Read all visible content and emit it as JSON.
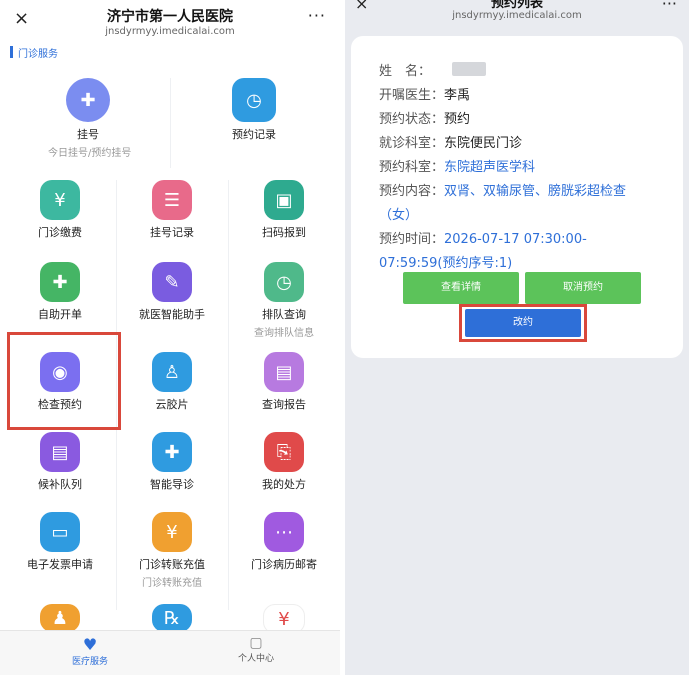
{
  "left": {
    "title": "济宁市第一人民医院",
    "subtitle": "jnsdyrmyy.imedicalai.com",
    "close_icon": "×",
    "more_icon": "···",
    "section": "门诊服务",
    "items": [
      {
        "label": "挂号",
        "sub": "今日挂号/预约挂号",
        "icon": "stethoscope-icon",
        "color": "#7b8df0"
      },
      {
        "label": "预约记录",
        "sub": "",
        "icon": "clock-icon",
        "color": "#2f9be0"
      },
      {
        "label": "门诊缴费",
        "sub": "",
        "icon": "yuan-house-icon",
        "color": "#3db8a0"
      },
      {
        "label": "挂号记录",
        "sub": "",
        "icon": "list-icon",
        "color": "#e86a8a"
      },
      {
        "label": "扫码报到",
        "sub": "",
        "icon": "scan-icon",
        "color": "#2eaa8f"
      },
      {
        "label": "自助开单",
        "sub": "",
        "icon": "form-icon",
        "color": "#45b565"
      },
      {
        "label": "就医智能助手",
        "sub": "",
        "icon": "assistant-icon",
        "color": "#7a5ce0"
      },
      {
        "label": "排队查询",
        "sub": "查询排队信息",
        "icon": "queue-icon",
        "color": "#4fb98a"
      },
      {
        "label": "检查预约",
        "sub": "",
        "icon": "planet-icon",
        "color": "#7b6ff0"
      },
      {
        "label": "云胶片",
        "sub": "",
        "icon": "body-icon",
        "color": "#2f9be0"
      },
      {
        "label": "查询报告",
        "sub": "",
        "icon": "report-icon",
        "color": "#b77ae0"
      },
      {
        "label": "候补队列",
        "sub": "",
        "icon": "doc-icon",
        "color": "#8a5ae0"
      },
      {
        "label": "智能导诊",
        "sub": "",
        "icon": "hospital-icon",
        "color": "#2f9be0"
      },
      {
        "label": "我的处方",
        "sub": "",
        "icon": "prescription-icon",
        "color": "#e04a4a"
      },
      {
        "label": "电子发票申请",
        "sub": "",
        "icon": "invoice-icon",
        "color": "#2f9be0"
      },
      {
        "label": "门诊转账充值",
        "sub": "门诊转账充值",
        "icon": "transfer-icon",
        "color": "#f0a030"
      },
      {
        "label": "门诊病历邮寄",
        "sub": "",
        "icon": "mail-icon",
        "color": "#a05ae0"
      }
    ],
    "glyphs": [
      "✚",
      "◷",
      "¥",
      "☰",
      "▣",
      "✚",
      "✎",
      "◷",
      "◉",
      "♙",
      "▤",
      "▤",
      "✚",
      "⎘",
      "▭",
      "¥",
      "⋯"
    ],
    "partial_glyphs": [
      "♟",
      "℞",
      "¥"
    ],
    "tabs": [
      {
        "label": "医疗服务",
        "icon": "heart-icon",
        "color": "#2e6fd8"
      },
      {
        "label": "个人中心",
        "icon": "person-icon",
        "color": "#555555"
      }
    ],
    "tab_glyphs": [
      "♥",
      "▢"
    ]
  },
  "right": {
    "title": "预约列表",
    "subtitle": "jnsdyrmyy.imedicalai.com",
    "close_icon": "×",
    "more_icon": "···",
    "fields": [
      {
        "key": "姓　名：",
        "value": "",
        "style": "v"
      },
      {
        "key": "开嘱医生：",
        "value": "李禹",
        "style": "v"
      },
      {
        "key": "预约状态：",
        "value": "预约",
        "style": "v"
      },
      {
        "key": "就诊科室：",
        "value": "东院便民门诊",
        "style": "v"
      },
      {
        "key": "预约科室：",
        "value": "东院超声医学科",
        "style": "blue"
      },
      {
        "key": "预约内容：",
        "value": "双肾、双输尿管、膀胱彩超检查",
        "style": "blue"
      },
      {
        "key": "",
        "value": "（女）",
        "style": "blue"
      },
      {
        "key": "预约时间：",
        "value": "2026-07-17 07:30:00-",
        "style": "blue"
      },
      {
        "key": "",
        "value": "07:59:59(预约序号:1)",
        "style": "blue"
      }
    ],
    "buttons": {
      "detail": "查看详情",
      "cancel": "取消预约",
      "reschedule": "改约"
    },
    "colors": {
      "green": "#5cc35a",
      "blue": "#2e6fd8",
      "red": "#d9483b"
    }
  }
}
